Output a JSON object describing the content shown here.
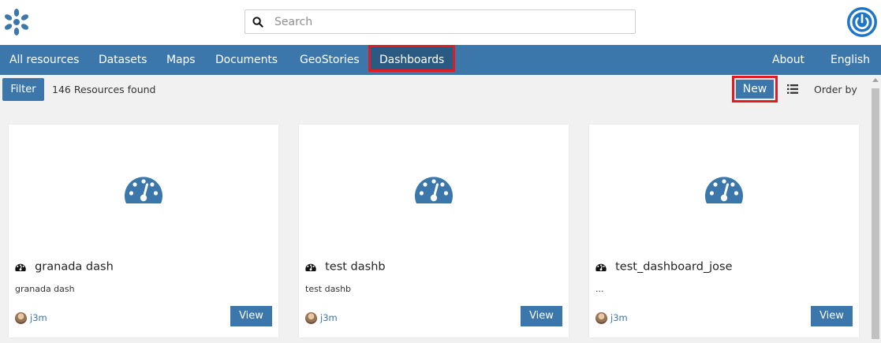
{
  "header": {
    "search_placeholder": "Search"
  },
  "navbar": {
    "items": [
      {
        "label": "All resources"
      },
      {
        "label": "Datasets"
      },
      {
        "label": "Maps"
      },
      {
        "label": "Documents"
      },
      {
        "label": "GeoStories"
      },
      {
        "label": "Dashboards",
        "active": true
      }
    ],
    "right_items": [
      {
        "label": "About"
      },
      {
        "label": "English"
      }
    ]
  },
  "toolbar": {
    "filter_label": "Filter",
    "result_count": "146 Resources found",
    "new_label": "New",
    "order_by_label": "Order by"
  },
  "cards": [
    {
      "title": "granada dash",
      "description": "granada dash",
      "owner": "j3m",
      "view_label": "View"
    },
    {
      "title": "test dashb",
      "description": "test dashb",
      "owner": "j3m",
      "view_label": "View"
    },
    {
      "title": "test_dashboard_jose",
      "description": "...",
      "owner": "j3m",
      "view_label": "View"
    }
  ],
  "colors": {
    "brand": "#3c77ab",
    "highlight": "#e11b22",
    "background": "#f2f1f2"
  },
  "icons": [
    "logo-icon",
    "search-icon",
    "power-icon",
    "list-view-icon",
    "dashboard-gauge-icon",
    "user-avatar"
  ]
}
